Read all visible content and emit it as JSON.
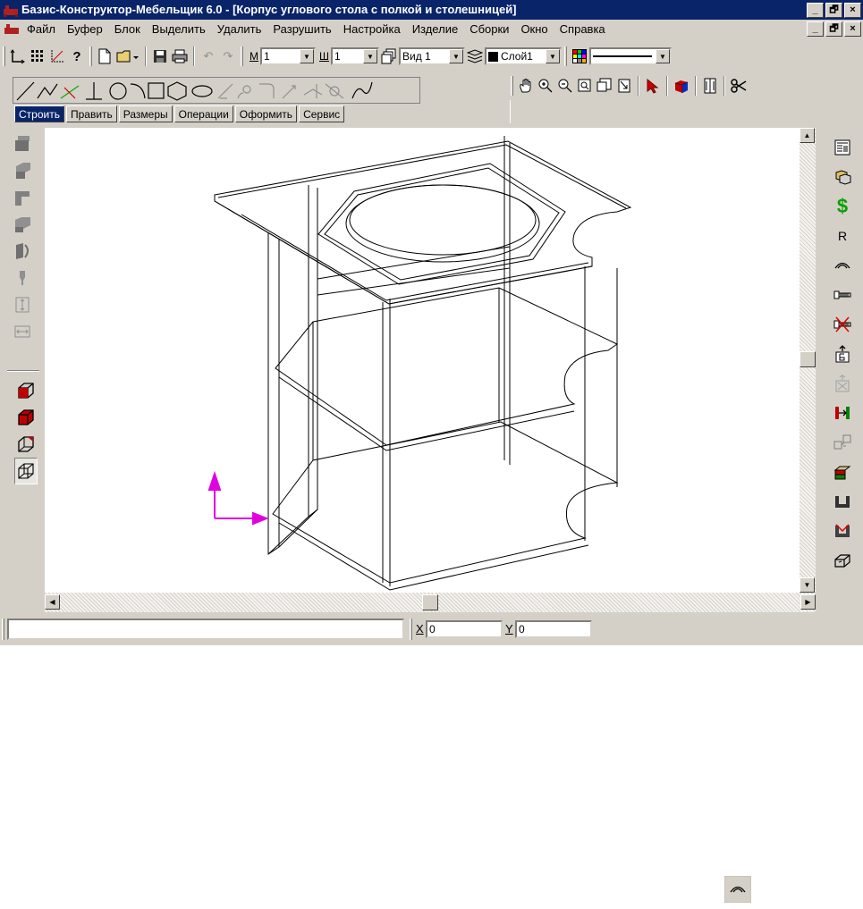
{
  "window": {
    "title": "Базис-Конструктор-Мебельщик 6.0 - [Корпус углового стола с полкой и столешницей]",
    "controls": [
      "_",
      "🗗",
      "×"
    ]
  },
  "menu": {
    "items": [
      "Файл",
      "Буфер",
      "Блок",
      "Выделить",
      "Удалить",
      "Разрушить",
      "Настройка",
      "Изделие",
      "Сборки",
      "Окно",
      "Справка"
    ]
  },
  "toolbar": {
    "scale_label": "М",
    "scale_value": "1",
    "step_label": "Ш",
    "step_value": "1",
    "view_value": "Вид 1",
    "layer_value": "Слой1"
  },
  "tabs": [
    {
      "label": "Строить",
      "active": true
    },
    {
      "label": "Править",
      "active": false
    },
    {
      "label": "Размеры",
      "active": false
    },
    {
      "label": "Операции",
      "active": false
    },
    {
      "label": "Оформить",
      "active": false
    },
    {
      "label": "Сервис",
      "active": false
    }
  ],
  "status": {
    "command_text": "",
    "x_label": "X",
    "x_value": "0",
    "y_label": "Y",
    "y_value": "0"
  },
  "icons": {
    "right_panel": [
      "properties-icon",
      "objects-icon",
      "dollar-icon",
      "radius-icon",
      "arc-edge-icon",
      "screw-icon",
      "remove-screw-icon",
      "export-icon",
      "disabled-export-icon",
      "fitting-icon",
      "assembly-icon",
      "drawer-icon",
      "profile-icon",
      "cut-icon",
      "box-icon"
    ],
    "left_panel": [
      "panel-front-icon",
      "panel-side-icon",
      "panel-back-icon",
      "panel-bent-icon",
      "panel-curved-icon",
      "brush-icon",
      "vertical-size-icon",
      "horizontal-size-icon",
      "cube-front-icon",
      "cube-solid-icon",
      "cube-axis-icon",
      "cube-wire-icon"
    ]
  },
  "colors": {
    "titlebar": "#0a246a",
    "axis": "#e000e0",
    "dollar": "#0aa000"
  }
}
